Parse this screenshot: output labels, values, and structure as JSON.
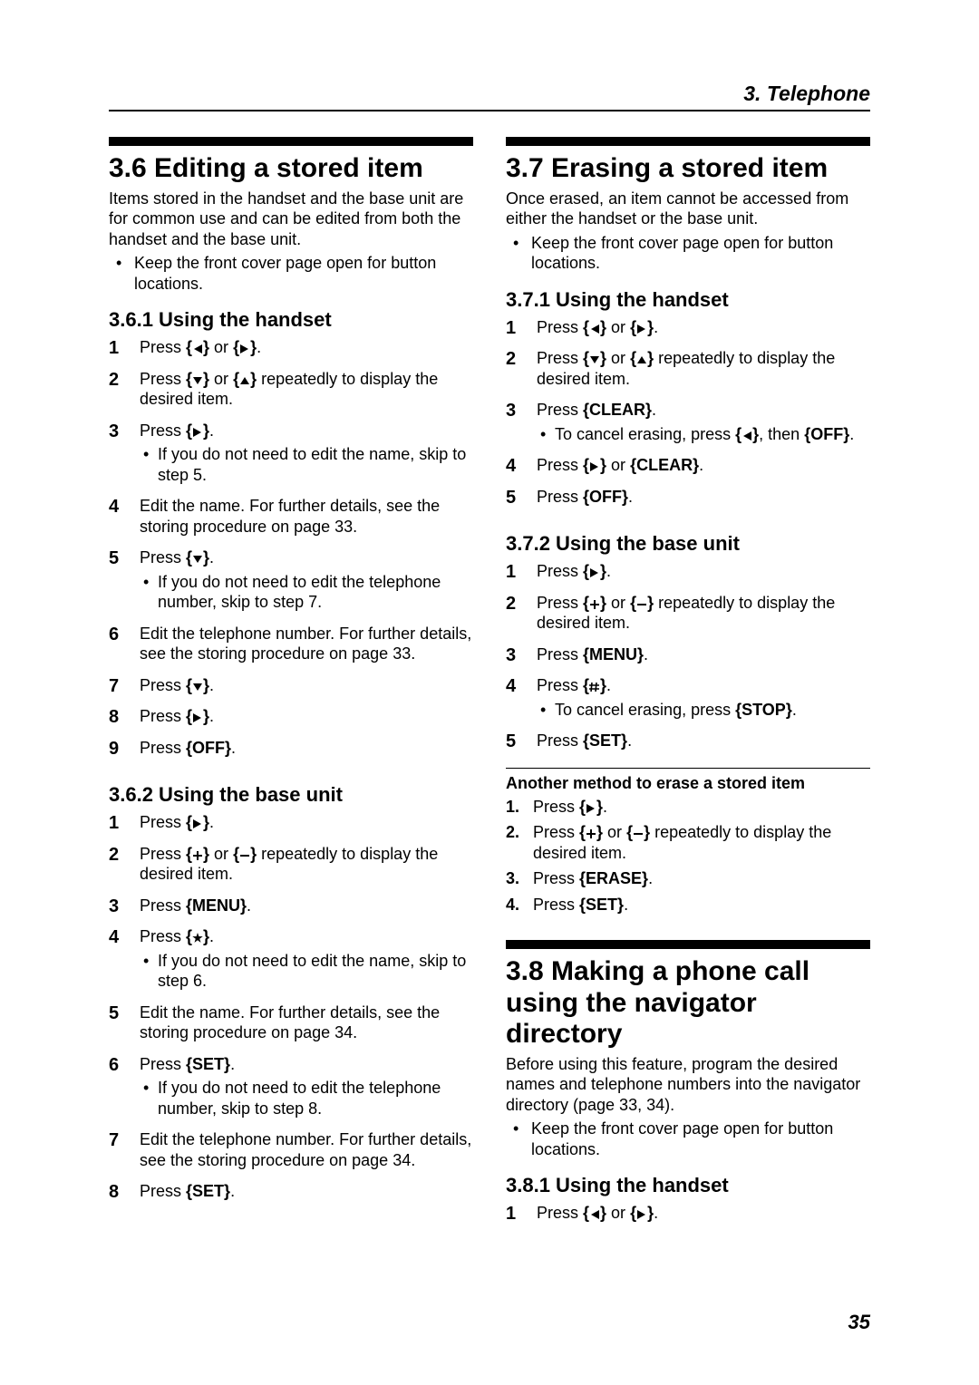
{
  "chapter": "3. Telephone",
  "pageNumber": "35",
  "keys": {
    "CLEAR": "CLEAR",
    "OFF": "OFF",
    "MENU": "MENU",
    "SET": "SET",
    "STOP": "STOP",
    "ERASE": "ERASE"
  },
  "left": {
    "s36": {
      "title": "3.6 Editing a stored item",
      "intro": "Items stored in the handset and the base unit are for common use and can be edited from both the handset and the base unit.",
      "bullet": "Keep the front cover page open for button locations.",
      "s361": {
        "title": "3.6.1 Using the handset",
        "steps": {
          "1a": "Press ",
          "1b": " or ",
          "1c": ".",
          "2a": "Press ",
          "2b": " or ",
          "2c": " repeatedly to display the desired item.",
          "3a": "Press ",
          "3b": ".",
          "3sub": "If you do not need to edit the name, skip to step 5.",
          "4": "Edit the name. For further details, see the storing procedure on page 33.",
          "5a": "Press ",
          "5b": ".",
          "5sub": "If you do not need to edit the telephone number, skip to step 7.",
          "6": "Edit the telephone number. For further details, see the storing procedure on page 33.",
          "7a": "Press ",
          "7b": ".",
          "8a": "Press ",
          "8b": ".",
          "9a": "Press ",
          "9b": "."
        }
      },
      "s362": {
        "title": "3.6.2 Using the base unit",
        "steps": {
          "1a": "Press ",
          "1b": ".",
          "2a": "Press ",
          "2b": " or ",
          "2c": " repeatedly to display the desired item.",
          "3a": "Press ",
          "3b": ".",
          "4a": "Press ",
          "4b": ".",
          "4sub": "If you do not need to edit the name, skip to step 6.",
          "5": "Edit the name. For further details, see the storing procedure on page 34.",
          "6a": "Press ",
          "6b": ".",
          "6sub": "If you do not need to edit the telephone number, skip to step 8.",
          "7": "Edit the telephone number. For further details, see the storing procedure on page 34.",
          "8a": "Press ",
          "8b": "."
        }
      }
    }
  },
  "right": {
    "s37": {
      "title": "3.7 Erasing a stored item",
      "intro": "Once erased, an item cannot be accessed from either the handset or the base unit.",
      "bullet": "Keep the front cover page open for button locations.",
      "s371": {
        "title": "3.7.1 Using the handset",
        "steps": {
          "1a": "Press ",
          "1b": " or ",
          "1c": ".",
          "2a": "Press ",
          "2b": " or ",
          "2c": " repeatedly to display the desired item.",
          "3a": "Press ",
          "3b": ".",
          "3subA": "To cancel erasing, press ",
          "3subB": ", then ",
          "3subC": ".",
          "4a": "Press ",
          "4b": " or ",
          "4c": ".",
          "5a": "Press ",
          "5b": "."
        }
      },
      "s372": {
        "title": "3.7.2 Using the base unit",
        "steps": {
          "1a": "Press ",
          "1b": ".",
          "2a": "Press ",
          "2b": " or ",
          "2c": " repeatedly to display the desired item.",
          "3a": "Press ",
          "3b": ".",
          "4a": "Press ",
          "4b": ".",
          "4subA": "To cancel erasing, press ",
          "4subB": ".",
          "5a": "Press ",
          "5b": "."
        },
        "another": {
          "head": "Another method to erase a stored item",
          "1a": "Press ",
          "1b": ".",
          "2a": "Press ",
          "2b": " or ",
          "2c": " repeatedly to display the desired item.",
          "3a": "Press ",
          "3b": ".",
          "4a": "Press ",
          "4b": "."
        }
      }
    },
    "s38": {
      "title": "3.8 Making a phone call using the navigator directory",
      "intro": "Before using this feature, program the desired names and telephone numbers into the navigator directory (page 33, 34).",
      "bullet": "Keep the front cover page open for button locations.",
      "s381": {
        "title": "3.8.1 Using the handset",
        "steps": {
          "1a": "Press ",
          "1b": " or ",
          "1c": "."
        }
      }
    }
  }
}
